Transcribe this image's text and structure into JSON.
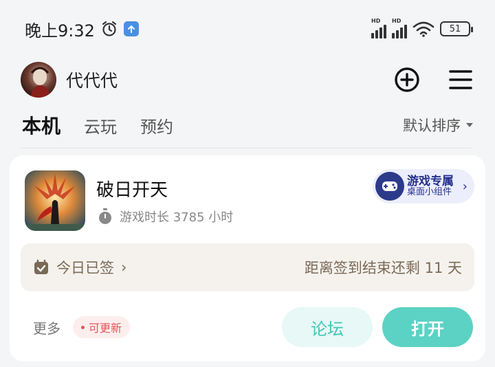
{
  "status_bar": {
    "time": "晚上9:32",
    "signal1_label": "HD",
    "signal2_label": "HD",
    "battery": "51",
    "icons": [
      "alarm-clock-icon",
      "upload-icon",
      "signal-icon",
      "wifi-icon",
      "battery-icon"
    ]
  },
  "header": {
    "username": "代代代",
    "icons": [
      "add-circle-icon",
      "menu-icon"
    ]
  },
  "tabs": [
    {
      "label": "本机",
      "active": true
    },
    {
      "label": "云玩",
      "active": false
    },
    {
      "label": "预约",
      "active": false
    }
  ],
  "sort": {
    "label": "默认排序"
  },
  "game": {
    "title": "破日开天",
    "playtime": "游戏时长 3785 小时",
    "widget_title": "游戏专属",
    "widget_subtitle": "桌面小组件",
    "signin_status": "今日已签",
    "signin_remaining": "距离签到结束还剩 11 天",
    "more_label": "更多",
    "update_label": "可更新",
    "forum_label": "论坛",
    "open_label": "打开"
  },
  "colors": {
    "accent": "#5cd2c4",
    "accent_light": "#e7f8f6",
    "update_red": "#e25656",
    "widget_blue": "#25308a"
  }
}
